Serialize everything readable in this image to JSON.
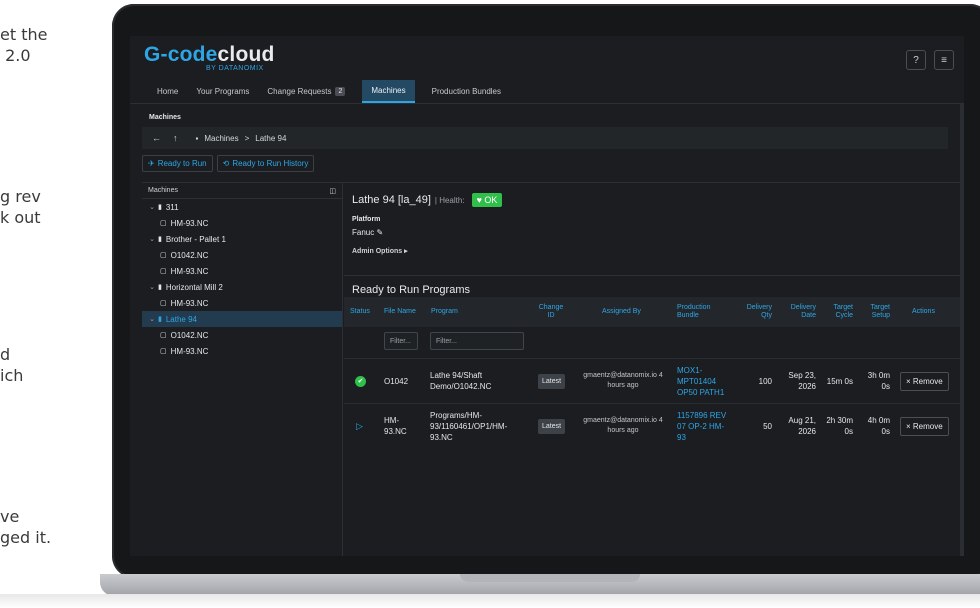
{
  "side_text": [
    "et the\n 2.0",
    "g rev\nk out",
    "d\nich",
    "ve\nged it."
  ],
  "colors": {
    "accent": "#2ea6e6",
    "ok": "#2fbf4a",
    "background": "#1b1d20"
  },
  "app": {
    "brand_part1": "G-code",
    "brand_part2": "cloud",
    "byline": "BY DATANOMIX",
    "help_icon": "?",
    "menu_icon": "≡"
  },
  "nav": {
    "items": [
      {
        "label": "Home"
      },
      {
        "label": "Your Programs"
      },
      {
        "label": "Change Requests",
        "badge": "2"
      },
      {
        "label": "Machines",
        "active": true
      },
      {
        "label": "Production Bundles"
      }
    ]
  },
  "machines_section": {
    "title": "Machines",
    "path_root": "Machines",
    "path_separator": ">",
    "path_current": "Lathe 94",
    "ready_to_run": "Ready to Run",
    "ready_to_run_history": "Ready to Run History"
  },
  "tree": {
    "header": "Machines",
    "collapse_icon": "◫",
    "rows": [
      {
        "label": "311",
        "level": 0,
        "type": "machine"
      },
      {
        "label": "HM-93.NC",
        "level": 1,
        "type": "file"
      },
      {
        "label": "Brother - Pallet 1",
        "level": 0,
        "type": "machine"
      },
      {
        "label": "O1042.NC",
        "level": 1,
        "type": "file"
      },
      {
        "label": "HM-93.NC",
        "level": 1,
        "type": "file"
      },
      {
        "label": "Horizontal Mill 2",
        "level": 0,
        "type": "machine"
      },
      {
        "label": "HM-93.NC",
        "level": 1,
        "type": "file"
      },
      {
        "label": "Lathe 94",
        "level": 0,
        "type": "machine",
        "selected": true
      },
      {
        "label": "O1042.NC",
        "level": 1,
        "type": "file"
      },
      {
        "label": "HM-93.NC",
        "level": 1,
        "type": "file"
      }
    ]
  },
  "detail": {
    "machine_title": "Lathe 94 [la_49]",
    "health_label": "| Health:",
    "health_value": "OK",
    "platform_label": "Platform",
    "platform_value": "Fanuc",
    "admin_options": "Admin Options",
    "ready_title": "Ready to Run Programs"
  },
  "table": {
    "headers": {
      "status": "Status",
      "file_name": "File Name",
      "program": "Program",
      "change_id": "Change ID",
      "assigned_by": "Assigned By",
      "production_bundle": "Production Bundle",
      "delivery_qty": "Delivery Qty",
      "delivery_date": "Delivery Date",
      "target_cycle": "Target Cycle",
      "target_setup": "Target Setup",
      "actions": "Actions"
    },
    "filter_placeholder_1": "Filter...",
    "filter_placeholder_2": "Filter...",
    "rows": [
      {
        "status": "ok",
        "file_name": "O1042",
        "program": "Lathe 94/Shaft Demo/O1042.NC",
        "change_id": "Latest",
        "assigned_by": "gmaentz@datanomix.io 4 hours ago",
        "production_bundle": "MOX1-MPT01404 OP50 PATH1",
        "delivery_qty": "100",
        "delivery_date": "Sep 23, 2026",
        "target_cycle": "15m 0s",
        "target_setup": "3h 0m 0s",
        "action": "× Remove"
      },
      {
        "status": "play",
        "file_name": "HM-93.NC",
        "program": "Programs/HM-93/1160461/OP1/HM-93.NC",
        "change_id": "Latest",
        "assigned_by": "gmaentz@datanomix.io 4 hours ago",
        "production_bundle": "1157896 REV 07 OP-2 HM-93",
        "delivery_qty": "50",
        "delivery_date": "Aug 21, 2026",
        "target_cycle": "2h 30m 0s",
        "target_setup": "4h 0m 0s",
        "action": "× Remove"
      }
    ]
  }
}
